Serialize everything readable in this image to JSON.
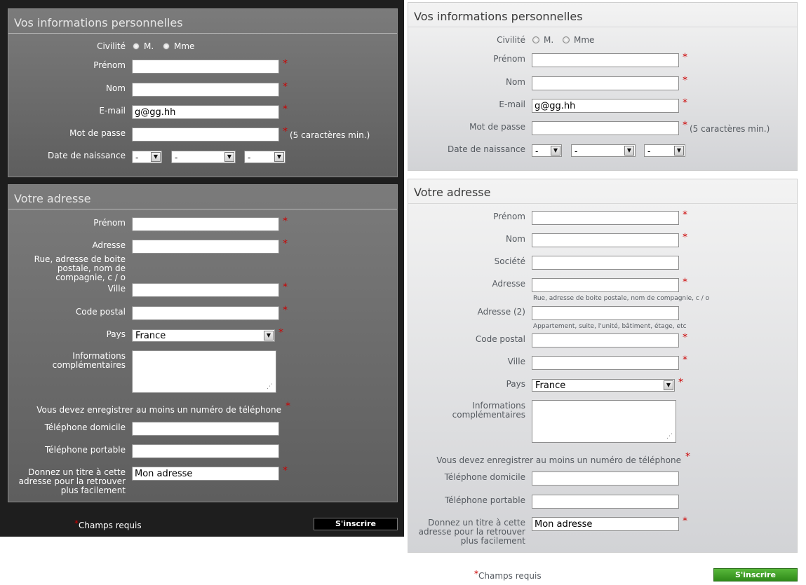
{
  "personal": {
    "title": "Vos informations personnelles",
    "civilite_label": "Civilité",
    "radio_m": "M.",
    "radio_mme": "Mme",
    "prenom_label": "Prénom",
    "nom_label": "Nom",
    "email_label": "E-mail",
    "email_value": "g@gg.hh",
    "password_label": "Mot de passe",
    "password_hint": "(5 caractères min.)",
    "birthdate_label": "Date de naissance",
    "birth_day": "-",
    "birth_month": "-",
    "birth_year": "-"
  },
  "address_dark": {
    "title": "Votre adresse",
    "prenom_label": "Prénom",
    "adresse_label": "Adresse",
    "adresse_hint": "Rue, adresse de boite\npostale, nom de\ncompagnie, c / o",
    "ville_label": "Ville",
    "code_postal_label": "Code postal",
    "pays_label": "Pays",
    "pays_value": "France",
    "info_label": "Informations\ncomplémentaires",
    "phone_notice": "Vous devez enregistrer au moins un numéro de téléphone",
    "tel_dom_label": "Téléphone domicile",
    "tel_port_label": "Téléphone portable",
    "alias_label": "Donnez un titre à cette\nadresse pour la retrouver\nplus facilement",
    "alias_value": "Mon adresse"
  },
  "address_light": {
    "title": "Votre adresse",
    "prenom_label": "Prénom",
    "nom_label": "Nom",
    "societe_label": "Société",
    "adresse_label": "Adresse",
    "adresse_hint": "Rue, adresse de boite postale, nom de compagnie, c / o",
    "adresse2_label": "Adresse (2)",
    "adresse2_hint": "Appartement, suite, l'unité, bâtiment, étage, etc",
    "code_postal_label": "Code postal",
    "ville_label": "Ville",
    "pays_label": "Pays",
    "pays_value": "France",
    "info_label": "Informations\ncomplémentaires",
    "phone_notice": "Vous devez enregistrer au moins un numéro de téléphone",
    "tel_dom_label": "Téléphone domicile",
    "tel_port_label": "Téléphone portable",
    "alias_label": "Donnez un titre à cette\nadresse pour la retrouver\nplus facilement",
    "alias_value": "Mon adresse"
  },
  "footer": {
    "required_star": "*",
    "required_text": "Champs requis",
    "submit_label": "S'inscrire"
  },
  "required_mark": "*",
  "colors": {
    "required": "#cc0000",
    "submit_dark": "#000000",
    "submit_green": "#3c9a24"
  }
}
